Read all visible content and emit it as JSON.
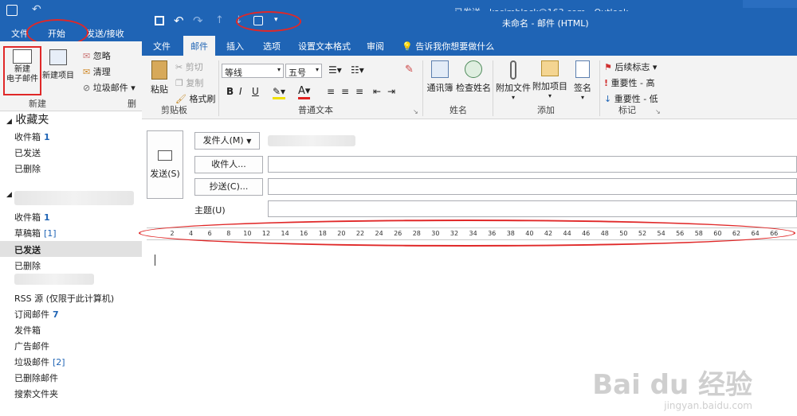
{
  "bg_window": {
    "title": "已发送 - kasimblack@163.com - Outlook",
    "tabs": [
      "文件",
      "开始",
      "发送/接收"
    ],
    "ribbon": {
      "new_mail": "新建\n电子邮件",
      "new_items": "新建项目",
      "ignore": "忽略",
      "clean": "清理",
      "junk": "垃圾邮件",
      "group_new": "新建",
      "group_delete": "删除"
    },
    "nav": {
      "favorites": "收藏夹",
      "fav_items": [
        {
          "label": "收件箱",
          "count": "1"
        },
        {
          "label": "已发送",
          "count": ""
        },
        {
          "label": "已删除",
          "count": ""
        }
      ],
      "items": [
        {
          "label": "收件箱",
          "count": "1"
        },
        {
          "label": "草稿箱",
          "bracket": "[1]"
        },
        {
          "label": "已发送",
          "count": "",
          "selected": true
        },
        {
          "label": "已删除",
          "count": ""
        },
        {
          "label": "RSS 源 (仅限于此计算机)",
          "count": ""
        },
        {
          "label": "订阅邮件",
          "count": "7"
        },
        {
          "label": "发件箱",
          "count": ""
        },
        {
          "label": "广告邮件",
          "count": ""
        },
        {
          "label": "垃圾邮件",
          "bracket": "[2]"
        },
        {
          "label": "已删除邮件",
          "count": ""
        },
        {
          "label": "搜索文件夹",
          "count": ""
        }
      ]
    }
  },
  "compose": {
    "title": "未命名 - 邮件 (HTML)",
    "tabs": [
      "文件",
      "邮件",
      "插入",
      "选项",
      "设置文本格式",
      "审阅"
    ],
    "tell_me": "告诉我你想要做什么",
    "clipboard": {
      "paste": "粘贴",
      "cut": "剪切",
      "copy": "复制",
      "format_painter": "格式刷",
      "label": "剪贴板"
    },
    "font": {
      "font_name": "等线",
      "font_size": "五号",
      "label": "普通文本"
    },
    "names": {
      "address_book": "通讯簿",
      "check_names": "检查姓名",
      "label": "姓名"
    },
    "include": {
      "attach_file": "附加文件",
      "attach_item": "附加项目",
      "signature": "签名",
      "label": "添加"
    },
    "tags": {
      "follow_up": "后续标志",
      "high": "重要性 - 高",
      "low": "重要性 - 低",
      "label": "标记"
    },
    "send": "发送(S)",
    "from": "发件人(M)",
    "to": "收件人...",
    "cc": "抄送(C)...",
    "subject": "主题(U)",
    "ruler_ticks": [
      "2",
      "4",
      "6",
      "8",
      "10",
      "12",
      "14",
      "16",
      "18",
      "20",
      "22",
      "24",
      "26",
      "28",
      "30",
      "32",
      "34",
      "36",
      "38",
      "40",
      "42",
      "44",
      "46",
      "48",
      "50",
      "52",
      "54",
      "56",
      "58",
      "60",
      "62",
      "64",
      "66"
    ]
  },
  "watermark": {
    "brand": "Bai du 经验",
    "url": "jingyan.baidu.com"
  }
}
